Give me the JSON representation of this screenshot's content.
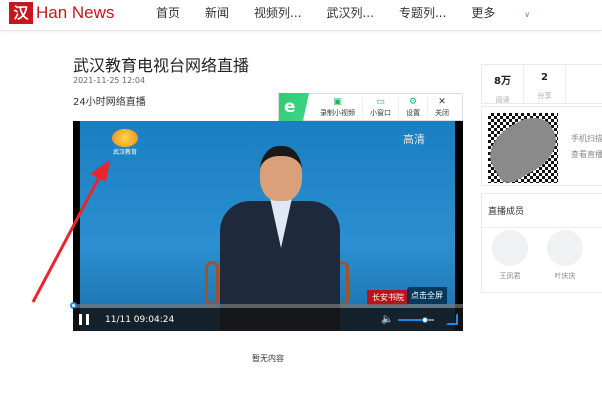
{
  "header": {
    "logo_mark": "汉",
    "logo_text": "Han News",
    "nav": [
      "首页",
      "新闻",
      "视频列...",
      "武汉列...",
      "专题列...",
      "更多"
    ]
  },
  "article": {
    "title": "武汉教育电视台网络直播",
    "date": "2021-11-25 12:04",
    "description": "24小时网络直播",
    "empty_text": "暂无内容"
  },
  "toolbar": {
    "logo": "e",
    "items": [
      {
        "label": "录制小视频",
        "icon": "video-record-icon"
      },
      {
        "label": "小窗口",
        "icon": "tv-icon"
      },
      {
        "label": "设置",
        "icon": "gear-icon"
      },
      {
        "label": "关闭",
        "icon": "close-icon"
      }
    ]
  },
  "player": {
    "station_logo": "武汉教育",
    "quality": "高清",
    "brand_logo": "长安书院",
    "fullscreen_tip": "点击全屏",
    "time": "11/11 09:04:24",
    "progress": 0,
    "volume": 0.75
  },
  "sidebar": {
    "stats": [
      {
        "value": "8万",
        "label": "阅读"
      },
      {
        "value": "2",
        "label": "分享"
      }
    ],
    "qr_lines": [
      "手机扫描",
      "查看直播"
    ],
    "members_title": "直播成员",
    "members": [
      "王凤君",
      "叶庆庆"
    ]
  },
  "colors": {
    "brand": "#c8161d",
    "accent": "#1e88e5",
    "toolbar_green": "#1fb35a"
  }
}
